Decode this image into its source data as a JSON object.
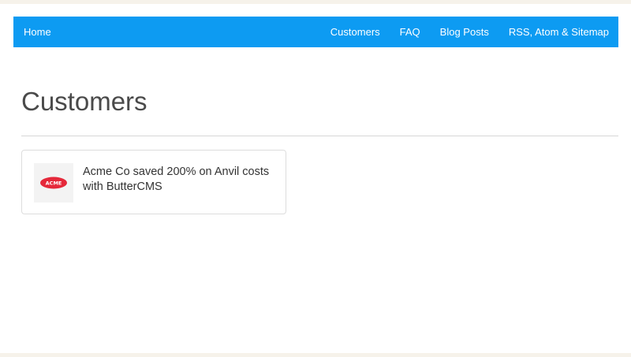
{
  "nav": {
    "home": "Home",
    "items": [
      "Customers",
      "FAQ",
      "Blog Posts",
      "RSS, Atom & Sitemap"
    ]
  },
  "page": {
    "title": "Customers"
  },
  "customers": [
    {
      "logo_text": "ACME",
      "headline": "Acme Co saved 200% on Anvil costs with ButterCMS"
    }
  ],
  "colors": {
    "navbar": "#0d9bf2",
    "logo_red": "#e5283a"
  }
}
